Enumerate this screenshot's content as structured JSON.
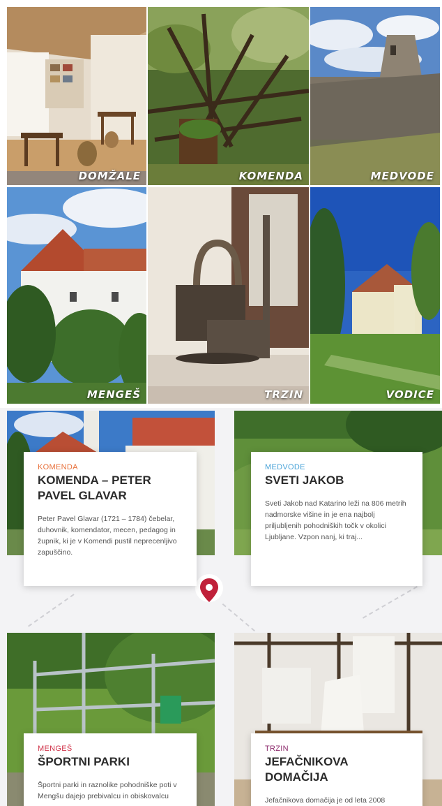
{
  "gallery": {
    "tiles": [
      {
        "label": "DOMŽALE"
      },
      {
        "label": "KOMENDA"
      },
      {
        "label": "MEDVODE"
      },
      {
        "label": "MENGEŠ"
      },
      {
        "label": "TRZIN"
      },
      {
        "label": "VODICE"
      }
    ]
  },
  "cards": [
    {
      "category": "KOMENDA",
      "category_color": "#e8703a",
      "title": "KOMENDA – PETER PAVEL GLAVAR",
      "description": "Peter Pavel Glavar (1721 – 1784) čebelar, duhovnik, komendator, mecen, pedagog in župnik, ki je v Komendi pustil neprecenljivo zapuščino."
    },
    {
      "category": "MEDVODE",
      "category_color": "#4aa3d8",
      "title": "SVETI JAKOB",
      "description": "Sveti Jakob nad Katarino leži na 806 metrih nadmorske višine in je ena najbolj priljubljenih pohodniških točk v okolici Ljubljane. Vzpon nanj, ki traj..."
    },
    {
      "category": "MENGEŠ",
      "category_color": "#d0344a",
      "title": "ŠPORTNI PARKI",
      "description": "Športni parki in raznolike pohodniške poti v Mengšu dajejo prebivalcu in obiskovalcu"
    },
    {
      "category": "TRZIN",
      "category_color": "#8e2d6e",
      "title": "JEFAČNIKOVA DOMAČIJA",
      "description": "Jefačnikova domačija je od leta 2008"
    }
  ],
  "colors": {
    "pin": "#c0213a"
  }
}
